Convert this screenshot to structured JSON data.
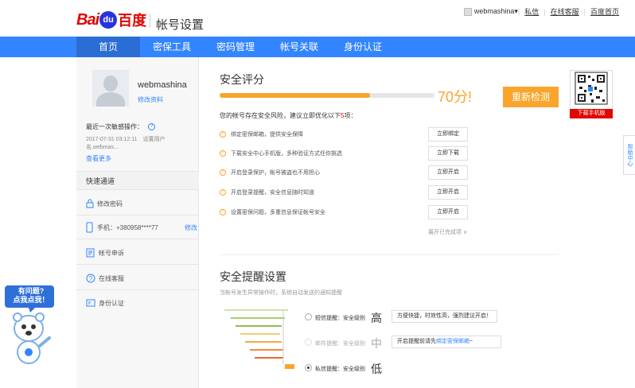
{
  "header": {
    "logo_text_bai": "Bai",
    "logo_text_du": "du",
    "logo_text_cn": "百度",
    "page_title": "帐号设置",
    "username": "webmashina",
    "links": [
      "私信",
      "在线客服",
      "百度首页"
    ]
  },
  "nav": {
    "items": [
      "首页",
      "密保工具",
      "密码管理",
      "帐号关联",
      "身份认证"
    ],
    "active_index": 0
  },
  "sidebar": {
    "username": "webmashina",
    "edit_profile": "修改资料",
    "last_op_label": "最近一次敏感操作：",
    "last_op_value": "2017-07-31 03:12:11　设置用户名,webmas...",
    "view_more": "查看更多",
    "quick_title": "快速通道",
    "quick_items": [
      {
        "label": "修改密码",
        "icon": "lock-icon"
      },
      {
        "label": "手机：+380958****77",
        "icon": "phone-icon",
        "action": "修改"
      },
      {
        "label": "帐号申诉",
        "icon": "appeal-icon"
      },
      {
        "label": "在线客服",
        "icon": "question-icon"
      },
      {
        "label": "身份认证",
        "icon": "id-card-icon"
      }
    ]
  },
  "security": {
    "title": "安全评分",
    "score": 70,
    "score_text": "70分!",
    "recheck_label": "重新检测",
    "hint_prefix": "您的帐号存在安全风险，建议立即优化以下",
    "hint_count": "5",
    "hint_suffix": "项：",
    "risks": [
      {
        "text": "绑定密保邮箱，提供安全保障",
        "button": "立即绑定"
      },
      {
        "text": "下载安全中心手机版，多种验证方式任你挑选",
        "button": "立即下载"
      },
      {
        "text": "开启登录保护，帐号被盗也不用担心",
        "button": "立即开启"
      },
      {
        "text": "开启登录提醒，安全信息随时知道",
        "button": "立即开启"
      },
      {
        "text": "设置密保问题，多重信息保证帐号安全",
        "button": "立即开启"
      }
    ],
    "expand_label": "展开已完成项 ∨"
  },
  "alerts": {
    "title": "安全提醒设置",
    "subtitle": "当帐号发生异常操作时，系统自动发送的通知提醒",
    "options": [
      {
        "label": "短信提醒：安全级别",
        "level": "高",
        "tip": "方便快捷，时效性高，强烈建议开启！",
        "selected": false
      },
      {
        "label": "邮件提醒：安全级别",
        "level": "中",
        "tip_prefix": "开启提醒前请先",
        "tip_link": "绑定密保邮箱",
        "tip_suffix": "~",
        "selected": false,
        "disabled": true
      },
      {
        "label": "私信提醒：安全级别",
        "level": "低",
        "selected": true
      }
    ]
  },
  "side_widgets": {
    "qr_button": "下载手机版",
    "feedback": "帮助中心"
  },
  "mascot": {
    "bubble_line1": "有问题?",
    "bubble_line2": "点我点我！"
  },
  "colors": {
    "nav_blue": "#3385ff",
    "accent_orange": "#f9a52b",
    "baidu_red": "#e10601"
  }
}
